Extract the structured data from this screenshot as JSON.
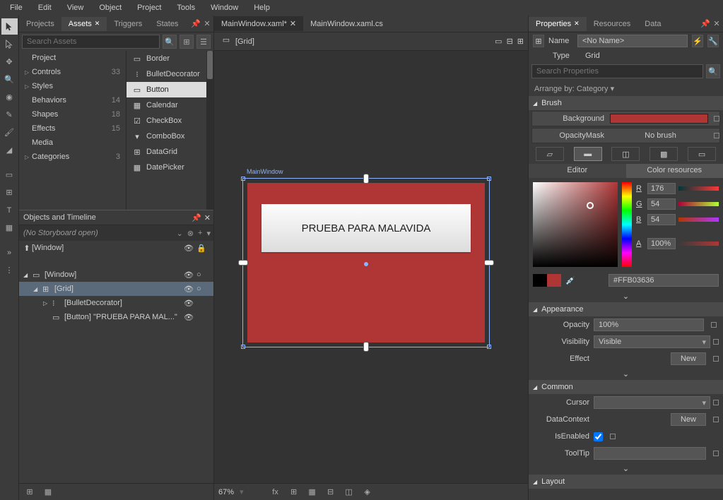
{
  "menu": [
    "File",
    "Edit",
    "View",
    "Object",
    "Project",
    "Tools",
    "Window",
    "Help"
  ],
  "leftTabs": [
    "Projects",
    "Assets",
    "Triggers",
    "States"
  ],
  "leftActiveTab": "Assets",
  "searchPlaceholder": "Search Assets",
  "assetCategories": [
    {
      "label": "Project",
      "count": "",
      "tri": ""
    },
    {
      "label": "Controls",
      "count": "33",
      "tri": "▷"
    },
    {
      "label": "Styles",
      "count": "",
      "tri": "▷"
    },
    {
      "label": "Behaviors",
      "count": "14",
      "tri": ""
    },
    {
      "label": "Shapes",
      "count": "18",
      "tri": ""
    },
    {
      "label": "Effects",
      "count": "15",
      "tri": ""
    },
    {
      "label": "Media",
      "count": "",
      "tri": ""
    },
    {
      "label": "Categories",
      "count": "3",
      "tri": "▷"
    }
  ],
  "assetList": [
    "Border",
    "BulletDecorator",
    "Button",
    "Calendar",
    "CheckBox",
    "ComboBox",
    "DataGrid",
    "DatePicker"
  ],
  "assetSelected": "Button",
  "objectsHeader": "Objects and Timeline",
  "storyboardText": "(No Storyboard open)",
  "windowCrumb": "[Window]",
  "objTree": [
    {
      "label": "[Window]",
      "indent": 0,
      "tri": "◢",
      "sel": false,
      "icon": "▭"
    },
    {
      "label": "[Grid]",
      "indent": 1,
      "tri": "◢",
      "sel": true,
      "icon": "⊞"
    },
    {
      "label": "[BulletDecorator]",
      "indent": 2,
      "tri": "▷",
      "sel": false,
      "icon": "⁝"
    },
    {
      "label": "[Button] \"PRUEBA PARA MAL...\"",
      "indent": 2,
      "tri": "",
      "sel": false,
      "icon": "▭"
    }
  ],
  "docTabs": [
    {
      "label": "MainWindow.xaml*",
      "active": true
    },
    {
      "label": "MainWindow.xaml.cs",
      "active": false
    }
  ],
  "breadcrumb": "[Grid]",
  "canvasLabel": "MainWindow",
  "buttonText": "PRUEBA PARA MALAVIDA",
  "zoom": "67%",
  "rightTabs": [
    "Properties",
    "Resources",
    "Data"
  ],
  "rightActiveTab": "Properties",
  "nameRow": {
    "label": "Name",
    "value": "<No Name>"
  },
  "typeRow": {
    "label": "Type",
    "value": "Grid"
  },
  "searchPropsPlaceholder": "Search Properties",
  "arrangeBy": "Arrange by: Category ▾",
  "brushSection": "Brush",
  "brushProps": [
    {
      "label": "Background",
      "type": "swatch"
    },
    {
      "label": "OpacityMask",
      "type": "none",
      "text": "No brush"
    }
  ],
  "editorTabs": {
    "left": "Editor",
    "right": "Color resources"
  },
  "rgba": {
    "R": "176",
    "G": "54",
    "B": "54",
    "A": "100%"
  },
  "hex": "#FFB03636",
  "appearanceSection": "Appearance",
  "appearance": {
    "opacity_label": "Opacity",
    "opacity": "100%",
    "visibility_label": "Visibility",
    "visibility": "Visible",
    "effect_label": "Effect",
    "effect_btn": "New"
  },
  "commonSection": "Common",
  "common": {
    "cursor_label": "Cursor",
    "cursor": "",
    "datacontext_label": "DataContext",
    "dc_btn": "New",
    "isenabled_label": "IsEnabled",
    "tooltip_label": "ToolTip",
    "tooltip": ""
  },
  "layoutSection": "Layout"
}
